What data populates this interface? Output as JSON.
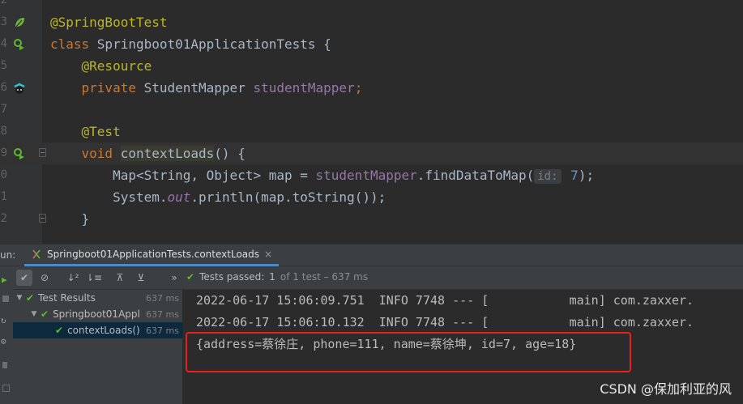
{
  "editor": {
    "lines": [
      {
        "num": "2"
      },
      {
        "num": "3",
        "ann": "@SpringBootTest"
      },
      {
        "num": "4",
        "kw": "class ",
        "text": "Springboot01ApplicationTests {"
      },
      {
        "num": "5",
        "ann": "@Resource"
      },
      {
        "num": "6",
        "kw": "private ",
        "type": "StudentMapper ",
        "field": "studentMapper",
        "semi": ";"
      },
      {
        "num": "7"
      },
      {
        "num": "8",
        "ann": "@Test"
      },
      {
        "num": "9",
        "kw": "void ",
        "method": "contextLoads",
        "rest": "() {"
      },
      {
        "num": "0",
        "a": "Map<String, Object> map = ",
        "b": "studentMapper",
        "c": ".findDataToMap(",
        "hint": "id:",
        "val": " 7",
        "d": ");"
      },
      {
        "num": "1",
        "a": "System.",
        "b": "out",
        "c": ".println(map.toString());"
      },
      {
        "num": "2",
        "text": "}"
      }
    ]
  },
  "run_panel": {
    "label": "un:",
    "tab_label": "Springboot01ApplicationTests.contextLoads",
    "tab_close": "×",
    "toolbar_more": "»",
    "status": {
      "passed": "Tests passed:",
      "count": "1",
      "of": "of 1 test – 637 ms"
    }
  },
  "test_tree": {
    "items": [
      {
        "label": "Test Results",
        "duration": "637 ms"
      },
      {
        "label": "Springboot01Appl",
        "duration": "637 ms"
      },
      {
        "label": "contextLoads()",
        "duration": "637 ms"
      }
    ]
  },
  "console": {
    "lines": [
      "2022-06-17 15:06:09.751  INFO 7748 --- [           main] com.zaxxer.",
      "2022-06-17 15:06:10.132  INFO 7748 --- [           main] com.zaxxer.",
      "{address=蔡徐庄, phone=111, name=蔡徐坤, id=7, age=18}"
    ]
  },
  "watermark": "CSDN @保加利亚的风",
  "colors": {
    "accent": "#4a88c7",
    "pass": "#5fb832",
    "highlight_box": "#e8211c"
  }
}
